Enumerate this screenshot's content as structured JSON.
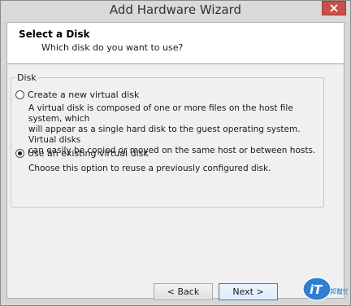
{
  "window": {
    "title": "Add Hardware Wizard",
    "close_icon": "close-icon"
  },
  "header": {
    "title": "Select a Disk",
    "subtitle": "Which disk do you want to use?"
  },
  "disk_group": {
    "legend": "Disk",
    "options": [
      {
        "label": "Create a new virtual disk",
        "selected": false,
        "description": [
          "A virtual disk is composed of one or more files on the host file system, which",
          "will appear as a single hard disk to the guest operating system. Virtual disks",
          "can easily be copied or moved on the same host or between hosts."
        ]
      },
      {
        "label": "Use an existing virtual disk",
        "selected": true,
        "description": [
          "Choose this option to reuse a previously configured disk."
        ]
      }
    ]
  },
  "buttons": {
    "back": "< Back",
    "next": "Next >"
  },
  "watermark": {
    "text_main": "iT",
    "text_small": "邦幫忙"
  },
  "colors": {
    "close_button": "#c7504a",
    "watermark_blue": "#2f7fd0"
  }
}
